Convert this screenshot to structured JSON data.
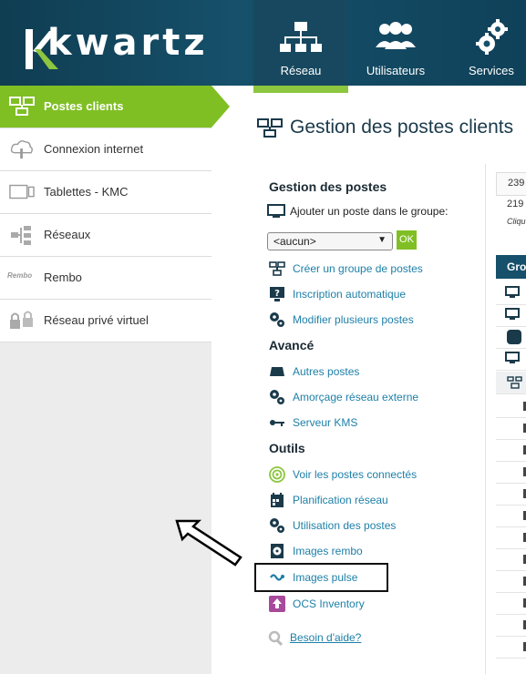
{
  "brand": {
    "logo_text": "kwartz",
    "logo_accent_color": "#8dc63f"
  },
  "topnav": {
    "tabs": [
      {
        "label": "Réseau",
        "icon": "network-icon",
        "active": true
      },
      {
        "label": "Utilisateurs",
        "icon": "users-icon",
        "active": false
      },
      {
        "label": "Services",
        "icon": "gears-icon",
        "active": false
      }
    ]
  },
  "sidebar": {
    "items": [
      {
        "label": "Postes clients",
        "icon": "computers-icon",
        "active": true
      },
      {
        "label": "Connexion internet",
        "icon": "cloud-hand-icon"
      },
      {
        "label": "Tablettes - KMC",
        "icon": "tablet-icon"
      },
      {
        "label": "Réseaux",
        "icon": "network-tree-icon"
      },
      {
        "label": "Rembo",
        "icon_text": "Rembo",
        "icon": "rembo-icon"
      },
      {
        "label": "Réseau privé virtuel",
        "icon": "locks-icon"
      }
    ]
  },
  "page": {
    "title": "Gestion des postes clients",
    "title_icon": "network-computers-icon"
  },
  "gestion": {
    "heading": "Gestion des postes",
    "add_label": "Ajouter un poste dans le groupe:",
    "group_select_value": "<aucun>",
    "ok_label": "OK",
    "links": [
      {
        "label": "Créer un groupe de postes",
        "icon": "group-computers-icon"
      },
      {
        "label": "Inscription automatique",
        "icon": "monitor-question-icon"
      },
      {
        "label": "Modifier plusieurs postes",
        "icon": "gears-icon"
      }
    ]
  },
  "avance": {
    "heading": "Avancé",
    "links": [
      {
        "label": "Autres postes",
        "icon": "device-icon"
      },
      {
        "label": "Amorçage réseau externe",
        "icon": "gears-icon"
      },
      {
        "label": "Serveur KMS",
        "icon": "key-icon"
      }
    ]
  },
  "outils": {
    "heading": "Outils",
    "links": [
      {
        "label": "Voir les postes connectés",
        "icon": "signal-icon"
      },
      {
        "label": "Planification réseau",
        "icon": "calendar-icon"
      },
      {
        "label": "Utilisation des postes",
        "icon": "gears-icon"
      },
      {
        "label": "Images rembo",
        "icon": "disk-image-icon"
      },
      {
        "label": "Images pulse",
        "icon": "pulse-logo-icon"
      },
      {
        "label": "OCS Inventory",
        "icon": "ocs-icon"
      }
    ]
  },
  "help": {
    "label": "Besoin d'aide?",
    "icon": "search-icon"
  },
  "right_panel": {
    "num1": "239",
    "num2": "219",
    "hint": "Cliqu",
    "table_header": "Gro"
  }
}
